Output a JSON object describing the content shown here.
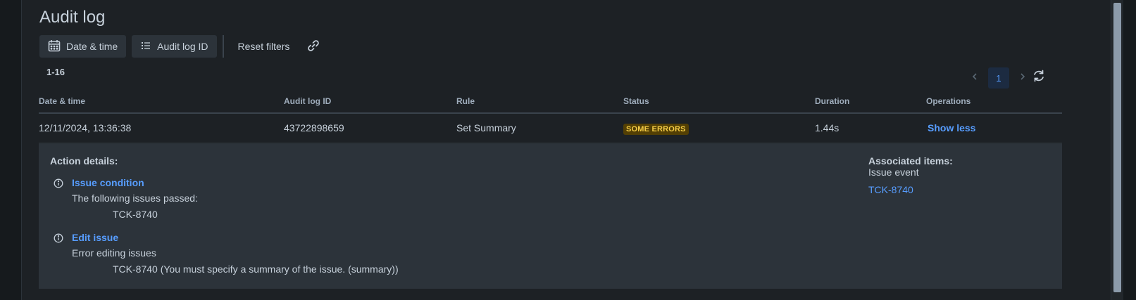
{
  "page": {
    "title": "Audit log"
  },
  "toolbar": {
    "date_time_label": "Date & time",
    "audit_log_id_label": "Audit log ID",
    "reset_filters_label": "Reset filters"
  },
  "results": {
    "range": "1-16"
  },
  "pagination": {
    "current_page": "1"
  },
  "table": {
    "headers": [
      "Date & time",
      "Audit log ID",
      "Rule",
      "Status",
      "Duration",
      "Operations"
    ],
    "rows": [
      {
        "date_time": "12/11/2024, 13:36:38",
        "audit_log_id": "43722898659",
        "rule": "Set Summary",
        "status": "SOME ERRORS",
        "duration": "1.44s",
        "operation": "Show less"
      }
    ]
  },
  "details": {
    "action_details_heading": "Action details:",
    "actions": [
      {
        "title": "Issue condition",
        "message": "The following issues passed:",
        "detail": "TCK-8740"
      },
      {
        "title": "Edit issue",
        "message": "Error editing issues",
        "detail": "TCK-8740 (You must specify a summary of the issue. (summary))"
      }
    ],
    "associated_heading": "Associated items:",
    "associated_type": "Issue event",
    "associated_item": "TCK-8740"
  },
  "colors": {
    "background": "#1d2125",
    "panel": "#2c333a",
    "link": "#579dff",
    "badge_bg": "#533f04",
    "badge_text": "#f5cd47"
  },
  "icons": [
    "calendar-icon",
    "list-icon",
    "link-icon",
    "chevron-left-icon",
    "chevron-right-icon",
    "refresh-icon",
    "info-icon",
    "scrollbar-thumb"
  ]
}
